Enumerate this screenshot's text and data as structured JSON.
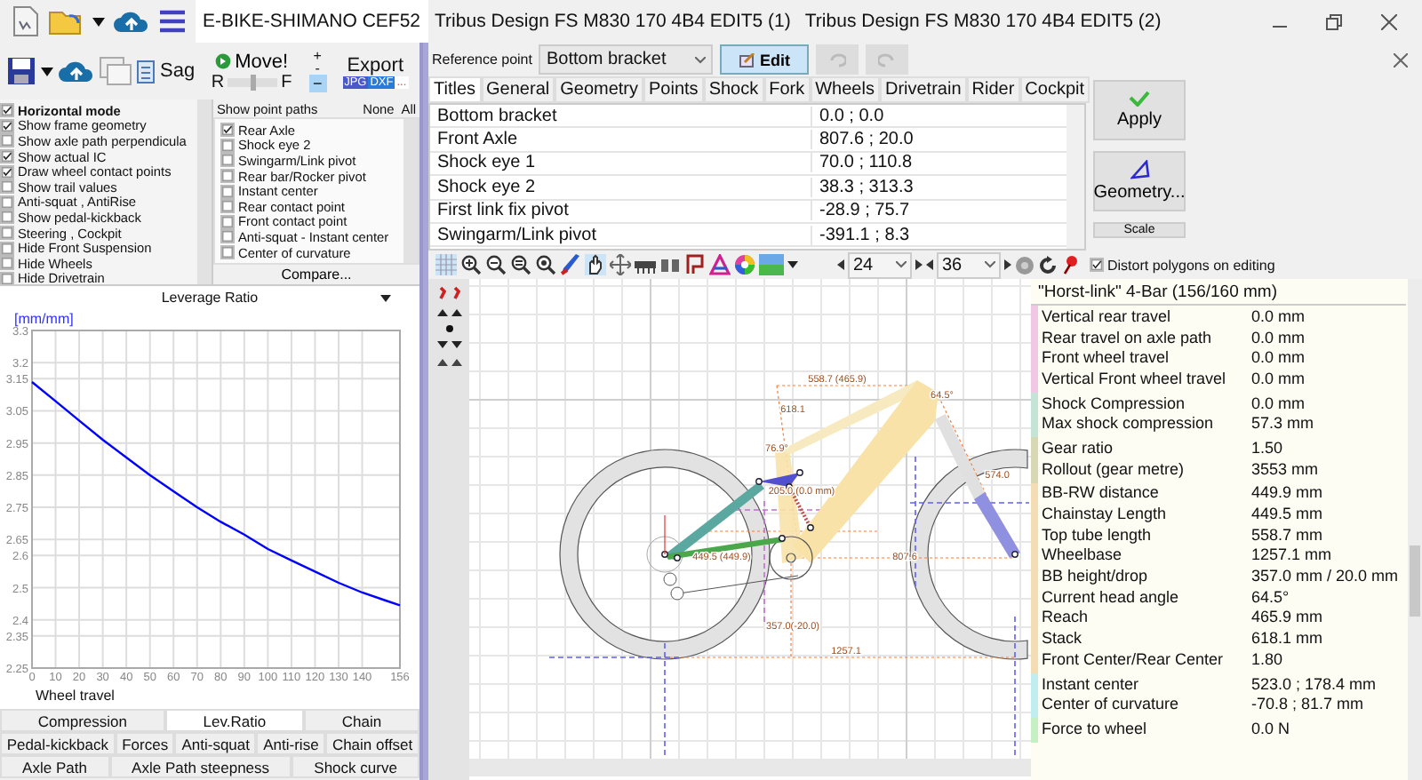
{
  "window": {
    "tabs": [
      {
        "label": "E-BIKE-SHIMANO CEF52",
        "selected": true
      },
      {
        "label": "Tribus Design FS M830 170 4B4 EDIT5 (1)",
        "selected": false
      },
      {
        "label": "Tribus Design FS M830 170 4B4 EDIT5 (2)",
        "selected": false
      }
    ]
  },
  "toolbar": {
    "sag_label": "Sag",
    "move_label": "Move!",
    "slider_left": "R",
    "slider_right": "F",
    "slider": {
      "level": 0.5
    },
    "plus": "+",
    "minus": "-",
    "step_button": {
      "label": "−",
      "on": true
    },
    "export_label": "Export",
    "export_formats": [
      "JPG",
      "DXF",
      "..."
    ]
  },
  "display_options": [
    {
      "label": "Horizontal mode",
      "kind": "heading",
      "checked": true
    },
    {
      "label": "Show frame geometry",
      "kind": "option",
      "checked": true
    },
    {
      "label": "Show axle path perpendicula",
      "kind": "option",
      "checked": false
    },
    {
      "label": "Show actual IC",
      "kind": "option",
      "checked": true
    },
    {
      "label": "Draw wheel contact points",
      "kind": "option",
      "checked": true
    },
    {
      "label": "Show trail values",
      "kind": "option",
      "checked": false
    },
    {
      "label": "Anti-squat , AntiRise",
      "kind": "option",
      "checked": false
    },
    {
      "label": "Show pedal-kickback",
      "kind": "option",
      "checked": false
    },
    {
      "label": "Steering ,  Cockpit",
      "kind": "option",
      "checked": false
    },
    {
      "label": "Hide Front Suspension",
      "kind": "option",
      "checked": false
    },
    {
      "label": "Hide Wheels",
      "kind": "option",
      "checked": false
    },
    {
      "label": "Hide Drivetrain",
      "kind": "option",
      "checked": false
    }
  ],
  "point_paths": {
    "title": "Show point paths",
    "none": "None",
    "all": "All",
    "compare": "Compare...",
    "items": [
      {
        "label": "Rear Axle",
        "checked": true
      },
      {
        "label": "Shock eye 2",
        "checked": false
      },
      {
        "label": "Swingarm/Link pivot",
        "checked": false
      },
      {
        "label": "Rear bar/Rocker pivot",
        "checked": false
      },
      {
        "label": "Instant center",
        "checked": false
      },
      {
        "label": "Rear contact point",
        "checked": false
      },
      {
        "label": "Front contact point",
        "checked": false
      },
      {
        "label": "Anti-squat - Instant center",
        "checked": false
      },
      {
        "label": "Center of curvature",
        "checked": false
      }
    ]
  },
  "leverage_chart": {
    "title": "Leverage Ratio",
    "unit": "[mm/mm]",
    "chart_data": {
      "type": "line",
      "xlabel": "Wheel travel",
      "x": [
        0,
        10,
        20,
        30,
        40,
        50,
        60,
        70,
        80,
        90,
        100,
        110,
        120,
        130,
        140,
        150,
        156
      ],
      "grid": true,
      "series": [
        {
          "color": "#0000ff",
          "values": [
            3.14,
            3.08,
            3.02,
            2.96,
            2.905,
            2.85,
            2.8,
            2.75,
            2.705,
            2.665,
            2.62,
            2.585,
            2.55,
            2.515,
            2.485,
            2.46,
            2.445
          ]
        }
      ],
      "xlim": [
        0,
        156
      ],
      "ylim": [
        2.25,
        3.3
      ],
      "xticks": [
        0,
        10,
        20,
        30,
        40,
        50,
        60,
        70,
        80,
        90,
        100,
        110,
        120,
        130,
        140,
        156
      ],
      "yticks": [
        2.25,
        2.35,
        2.4,
        2.5,
        2.6,
        2.65,
        2.75,
        2.85,
        2.95,
        3.05,
        3.15,
        3.2,
        3.3
      ]
    }
  },
  "chart_tabs": [
    [
      {
        "label": "Compression",
        "selected": false
      },
      {
        "label": "Lev.Ratio",
        "selected": true
      },
      {
        "label": "Chain",
        "selected": false
      }
    ],
    [
      {
        "label": "Pedal-kickback",
        "selected": false
      },
      {
        "label": "Forces",
        "selected": false
      },
      {
        "label": "Anti-squat",
        "selected": false
      },
      {
        "label": "Anti-rise",
        "selected": false
      },
      {
        "label": "Chain offset",
        "selected": false
      }
    ],
    [
      {
        "label": "Axle Path",
        "selected": false
      },
      {
        "label": "Axle Path steepness",
        "selected": false
      },
      {
        "label": "Shock curve",
        "selected": false
      }
    ]
  ],
  "editor": {
    "reference_label": "Reference point",
    "reference_value": "Bottom bracket",
    "edit_label": "Edit",
    "undo_disabled": true,
    "redo_disabled": true,
    "tabs": [
      {
        "label": "Titles",
        "selected": true
      },
      {
        "label": "General",
        "selected": false
      },
      {
        "label": "Geometry",
        "selected": false
      },
      {
        "label": "Points",
        "selected": false
      },
      {
        "label": "Shock",
        "selected": false
      },
      {
        "label": "Fork",
        "selected": false
      },
      {
        "label": "Wheels",
        "selected": false
      },
      {
        "label": "Drivetrain",
        "selected": false
      },
      {
        "label": "Rider",
        "selected": false
      },
      {
        "label": "Cockpit",
        "selected": false
      }
    ],
    "rows": [
      {
        "name": "Bottom bracket",
        "value": "0.0 ; 0.0"
      },
      {
        "name": "Front Axle",
        "value": "807.6 ; 20.0"
      },
      {
        "name": "Shock eye 1",
        "value": "70.0 ; 110.8"
      },
      {
        "name": "Shock eye 2",
        "value": "38.3 ; 313.3"
      },
      {
        "name": "First link fix pivot",
        "value": "-28.9 ; 75.7"
      },
      {
        "name": "Swingarm/Link pivot",
        "value": "-391.1 ; 8.3"
      }
    ],
    "apply_label": "Apply",
    "geometry_label": "Geometry...",
    "scale_label": "Scale"
  },
  "canvas_toolbar": {
    "spin_1": "24",
    "spin_2": "36",
    "distort": {
      "label": "Distort polygons on editing",
      "checked": true
    }
  },
  "drawing": {
    "dimension_labels": [
      "558.7 (465.9)",
      "618.1",
      "64.5°",
      "76.9°",
      "205.0 (0.0 mm)",
      "574.0",
      "449.5 (449.9)",
      "807.6",
      "357.0(-20.0)",
      "1257.1"
    ]
  },
  "info_panel": {
    "title": "\"Horst-link\" 4-Bar (156/160 mm)",
    "groups": [
      {
        "color": "#f0c8e4",
        "rows": [
          {
            "label": "Vertical rear travel",
            "value": "0.0 mm"
          },
          {
            "label": "Rear travel on axle path",
            "value": "0.0 mm"
          },
          {
            "label": "Front wheel travel",
            "value": "0.0 mm"
          },
          {
            "label": "Vertical Front wheel travel",
            "value": "0.0 mm"
          }
        ]
      },
      {
        "color": "#c4e4d8",
        "rows": [
          {
            "label": "Shock Compression",
            "value": "0.0 mm"
          },
          {
            "label": "Max shock compression",
            "value": "57.3 mm"
          }
        ]
      },
      {
        "color": "#d8d8b4",
        "rows": [
          {
            "label": "Gear ratio",
            "value": "1.50"
          },
          {
            "label": "Rollout (gear metre)",
            "value": "3553 mm"
          }
        ]
      },
      {
        "color": "#f4dcb4",
        "rows": [
          {
            "label": "BB-RW distance",
            "value": "449.9 mm"
          },
          {
            "label": "Chainstay Length",
            "value": "449.5 mm"
          },
          {
            "label": "Top tube length",
            "value": "558.7 mm"
          },
          {
            "label": "Wheelbase",
            "value": "1257.1 mm"
          },
          {
            "label": "BB height/drop",
            "value": "357.0 mm / 20.0 mm"
          },
          {
            "label": "Current head angle",
            "value": "64.5°"
          },
          {
            "label": "Reach",
            "value": "465.9 mm"
          },
          {
            "label": "Stack",
            "value": "618.1 mm"
          },
          {
            "label": "Front Center/Rear Center",
            "value": "1.80"
          }
        ]
      },
      {
        "color": "#c0eef0",
        "rows": [
          {
            "label": "Instant center",
            "value": "523.0 ; 178.4 mm"
          },
          {
            "label": "Center of curvature",
            "value": "-70.8 ; 81.7 mm"
          }
        ]
      },
      {
        "color": "#c4f0c4",
        "rows": [
          {
            "label": "Force to wheel",
            "value": "0.0 N"
          }
        ]
      }
    ]
  }
}
